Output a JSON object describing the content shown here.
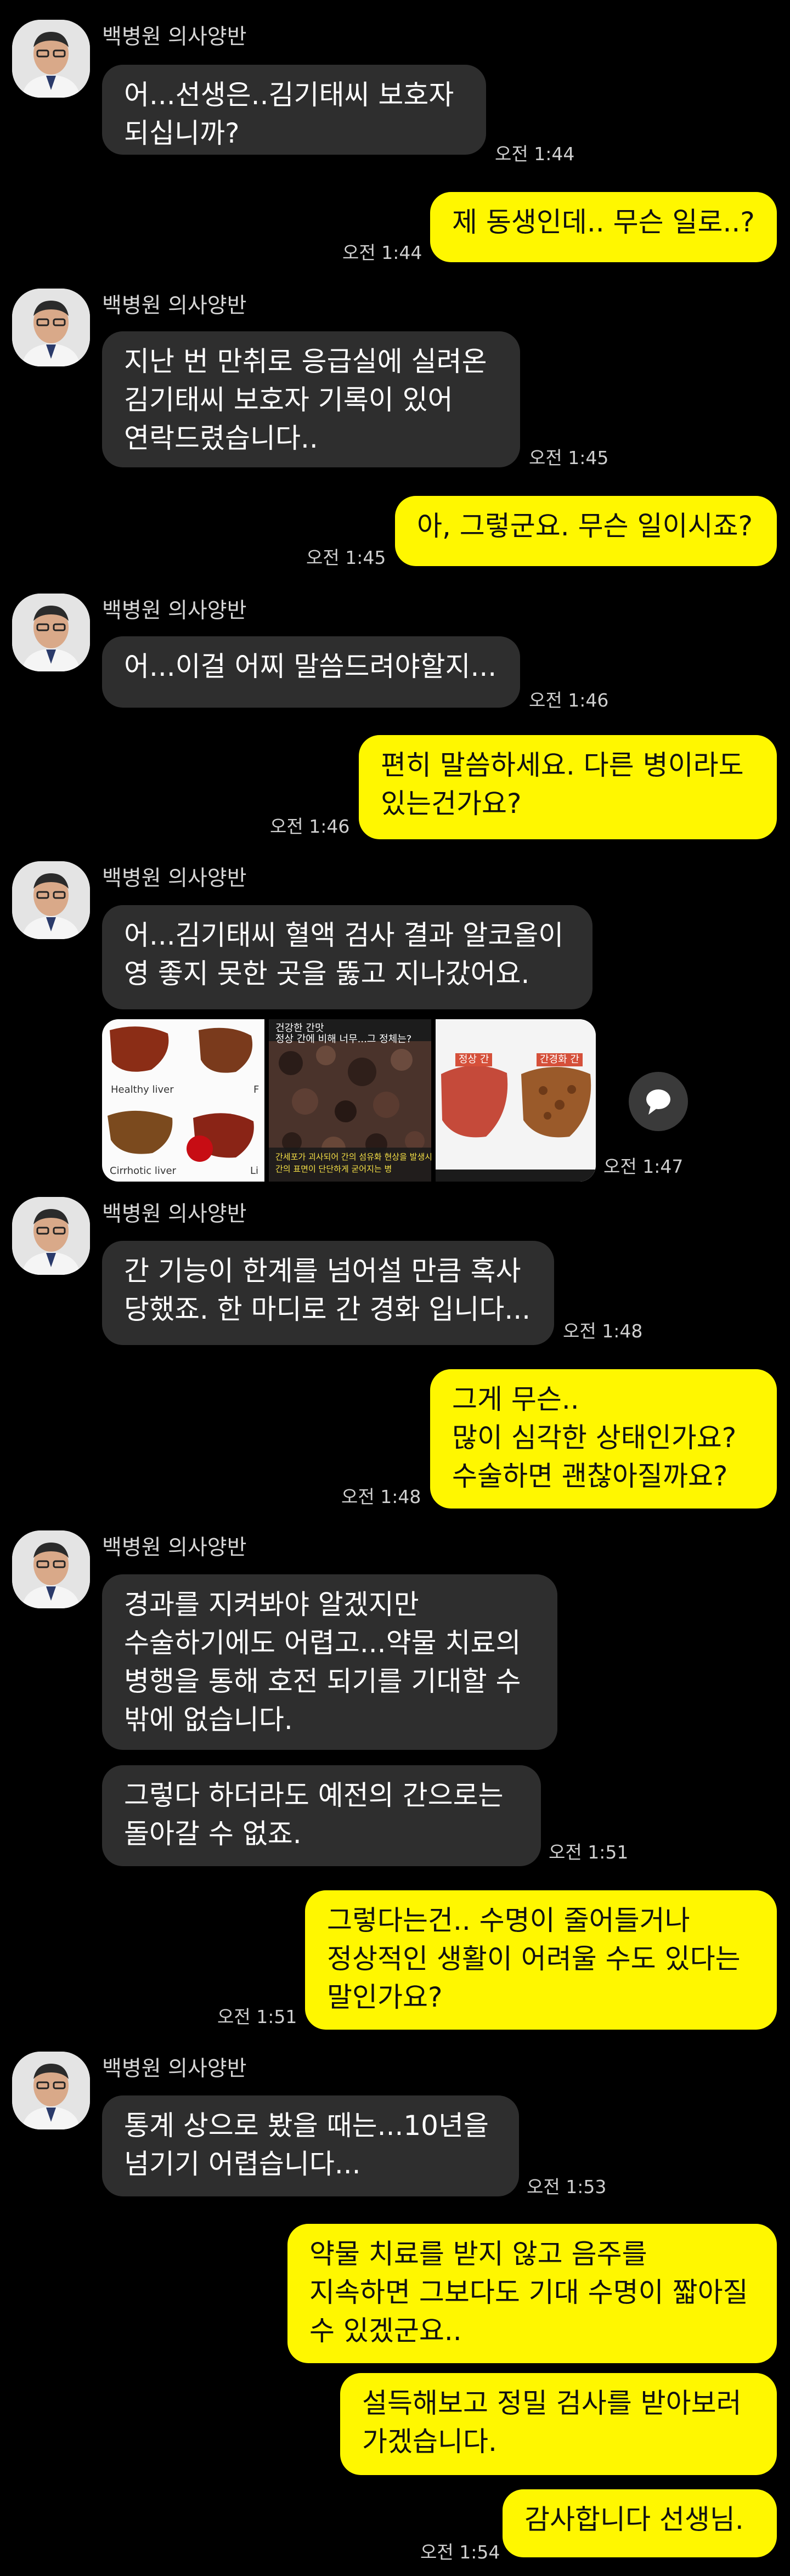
{
  "sender": {
    "name": "백병원 의사양반"
  },
  "messages": [
    {
      "text": "어...선생은..김기태씨 보호자\n되십니까?",
      "time": "오전 1:44"
    },
    {
      "text": "제 동생인데.. 무슨 일로..?",
      "time": "오전 1:44"
    },
    {
      "text": "지난 번 만취로 응급실에 실려온\n김기태씨 보호자 기록이 있어\n연락드렸습니다..",
      "time": "오전 1:45"
    },
    {
      "text": "아, 그렇군요. 무슨 일이시죠?",
      "time": "오전 1:45"
    },
    {
      "text": "어...이걸 어찌 말씀드려야할지...",
      "time": "오전 1:46"
    },
    {
      "text": "편히 말씀하세요. 다른 병이라도\n있는건가요?",
      "time": "오전 1:46"
    },
    {
      "text": "어...김기태씨 혈액 검사 결과 알코올이\n영 좋지 못한 곳을 뚫고 지나갔어요.",
      "time": ""
    },
    {
      "text": "",
      "time": "오전 1:47"
    },
    {
      "text": "간 기능이 한계를 넘어설 만큼 혹사\n당했죠. 한 마디로 간 경화 입니다...",
      "time": "오전 1:48"
    },
    {
      "text": "그게 무슨..\n많이 심각한 상태인가요?\n수술하면 괜찮아질까요?",
      "time": "오전 1:48"
    },
    {
      "text": "경과를 지켜봐야 알겠지만\n수술하기에도 어렵고...약물 치료의\n병행을 통해 호전 되기를 기대할 수\n밖에 없습니다.",
      "time": ""
    },
    {
      "text": "그렇다 하더라도 예전의 간으로는\n돌아갈 수 없죠.",
      "time": "오전 1:51"
    },
    {
      "text": "그렇다는건.. 수명이 줄어들거나\n정상적인 생활이 어려울 수도 있다는\n말인가요?",
      "time": "오전 1:51"
    },
    {
      "text": "통계 상으로 봤을 때는...10년을\n넘기기 어렵습니다...",
      "time": "오전 1:53"
    },
    {
      "text": "약물 치료를 받지 않고 음주를\n지속하면 그보다도 기대 수명이 짧아질\n수 있겠군요..",
      "time": ""
    },
    {
      "text": "설득해보고 정밀 검사를 받아보러\n가겠습니다.",
      "time": ""
    },
    {
      "text": "감사합니다 선생님.",
      "time": "오전 1:54"
    }
  ],
  "images": [
    {
      "labels": [
        "Healthy liver",
        "Cirrhotic liver",
        "F",
        "Li"
      ]
    },
    {
      "labels": [
        "건강한 간맛",
        "정상 간에 비해 너무...그 정체는?",
        "간세포가 괴사되어 간의 섬유화 현상을 발생시켜",
        "간의 표면이 단단하게 굳어지는 병"
      ]
    },
    {
      "labels": [
        "정상 간",
        "간경화 간"
      ]
    }
  ],
  "colors": {
    "background": "#000000",
    "incoming_bubble": "#2e2e2e",
    "outgoing_bubble": "#fff700",
    "timestamp": "#cfcfcf"
  },
  "icons": {
    "avatar": "doctor-avatar",
    "share": "chat-bubble-icon"
  }
}
